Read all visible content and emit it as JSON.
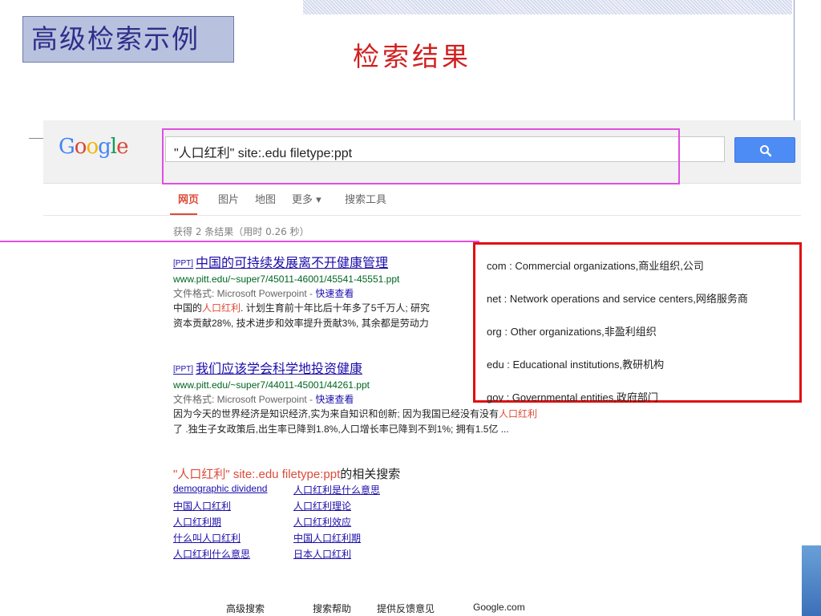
{
  "slide": {
    "title": "高级检索示例",
    "subtitle": "检索结果"
  },
  "google": {
    "logo": "Google",
    "query": "\"人口红利\" site:.edu filetype:ppt",
    "search_button_icon": "search-icon",
    "nav": [
      "网页",
      "图片",
      "地图",
      "更多 ▾",
      "搜索工具"
    ],
    "stats": "获得 2 条结果（用时 0.26 秒）"
  },
  "results": [
    {
      "tag": "[PPT]",
      "title": "中国的可持续发展离不开健康管理",
      "url": "www.pitt.edu/~super7/45011-46001/45541-45551.ppt",
      "format_label": "文件格式: Microsoft Powerpoint - ",
      "quick_view": "快速查看",
      "snippet1_pre": "中国的",
      "snippet1_hl": "人口红利",
      "snippet1_post": ". 计划生育前十年比后十年多了5千万人; 研究",
      "snippet2": "资本贡献28%, 技术进步和效率提升贡献3%, 其余都是劳动力"
    },
    {
      "tag": "[PPT]",
      "title": "我们应该学会科学地投资健康",
      "url": "www.pitt.edu/~super7/44011-45001/44261.ppt",
      "format_label": "文件格式: Microsoft Powerpoint - ",
      "quick_view": "快速查看",
      "snippet1_pre": "因为今天的世界经济是知识经济,实为来自知识和创新; 因为我国已经没有没有",
      "snippet1_hl": "人口红利",
      "snippet2": "了 .独生子女政策后,出生率已降到1.8%,人口增长率已降到不到1%; 拥有1.5亿 ..."
    }
  ],
  "related": {
    "query": "\"人口红利\" site:.edu filetype:ppt",
    "suffix": "的相关搜索",
    "left": [
      "demographic dividend",
      "中国人口红利",
      "人口红利期",
      "什么叫人口红利",
      "人口红利什么意思"
    ],
    "right": [
      "人口红利是什么意思",
      "人口红利理论",
      "人口红利效应",
      "中国人口红利期",
      "日本人口红利"
    ]
  },
  "tld_list": [
    "com : Commercial organizations,商业组织,公司",
    "net : Network operations and service centers,网络服务商",
    "org : Other organizations,非盈利组织",
    "edu : Educational institutions,教研机构",
    "gov : Governmental entities,政府部门"
  ],
  "footer": [
    "高级搜索",
    "搜索帮助",
    "提供反馈意见",
    "Google.com"
  ],
  "colors": {
    "title_bg": "#b8c2de",
    "subtitle": "#d02020",
    "link": "#1a0dab",
    "url": "#006621",
    "highlight": "#dd4b39",
    "search_button": "#4d8cf5",
    "annotation_box": "#e01010",
    "annotation_pink": "#e050e0"
  }
}
